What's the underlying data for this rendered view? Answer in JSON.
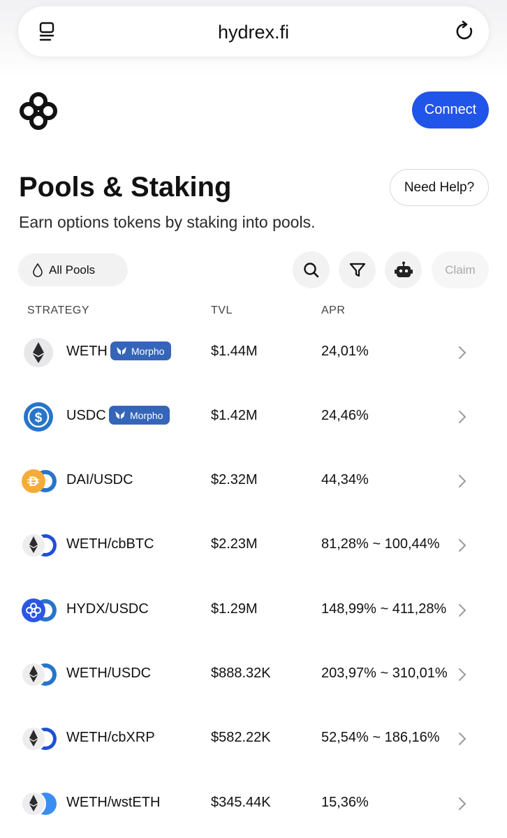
{
  "browser": {
    "url": "hydrex.fi"
  },
  "header": {
    "connect_label": "Connect"
  },
  "page": {
    "title": "Pools & Staking",
    "subtitle": "Earn options tokens by staking into pools.",
    "help_label": "Need Help?"
  },
  "toolbar": {
    "filter_label": "All Pools",
    "claim_label": "Claim"
  },
  "table": {
    "headers": {
      "strategy": "STRATEGY",
      "tvl": "TVL",
      "apr": "APR"
    },
    "rows": [
      {
        "name": "WETH",
        "badge": "Morpho",
        "tvl": "$1.44M",
        "apr": "24,01%",
        "icon": "weth-icon"
      },
      {
        "name": "USDC",
        "badge": "Morpho",
        "tvl": "$1.42M",
        "apr": "24,46%",
        "icon": "usdc-icon"
      },
      {
        "name": "DAI/USDC",
        "badge": "",
        "tvl": "$2.32M",
        "apr": "44,34%",
        "icon": "dai-usdc-pair-icon"
      },
      {
        "name": "WETH/cbBTC",
        "badge": "",
        "tvl": "$2.23M",
        "apr": "81,28% ~ 100,44%",
        "icon": "weth-cbbtc-pair-icon"
      },
      {
        "name": "HYDX/USDC",
        "badge": "",
        "tvl": "$1.29M",
        "apr": "148,99% ~ 411,28%",
        "icon": "hydx-usdc-pair-icon"
      },
      {
        "name": "WETH/USDC",
        "badge": "",
        "tvl": "$888.32K",
        "apr": "203,97% ~ 310,01%",
        "icon": "weth-usdc-pair-icon"
      },
      {
        "name": "WETH/cbXRP",
        "badge": "",
        "tvl": "$582.22K",
        "apr": "52,54% ~ 186,16%",
        "icon": "weth-cbxrp-pair-icon"
      },
      {
        "name": "WETH/wstETH",
        "badge": "",
        "tvl": "$345.44K",
        "apr": "15,36%",
        "icon": "weth-wsteth-pair-icon"
      }
    ]
  },
  "colors": {
    "accent": "#2154e8",
    "badge": "#3565b8",
    "usdc": "#2775ca",
    "dai": "#f5ac37",
    "hydx": "#2a55e5"
  }
}
